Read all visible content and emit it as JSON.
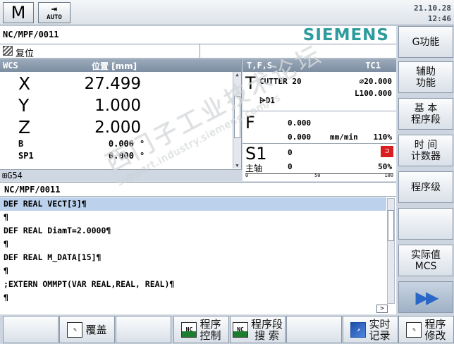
{
  "header": {
    "mode_jog_label": "M",
    "mode_auto_label": "AUTO",
    "date": "21.10.28",
    "time": "12:46"
  },
  "path": "NC/MPF/0011",
  "brand": "SIEMENS",
  "status": {
    "label": "复位"
  },
  "wcs": {
    "title": "WCS",
    "position_label": "位置 [mm]",
    "axes": [
      {
        "name": "X",
        "value": "27.499"
      },
      {
        "name": "Y",
        "value": "1.000"
      },
      {
        "name": "Z",
        "value": "2.000"
      }
    ],
    "aux_axes": [
      {
        "name": "B",
        "value": "0.000",
        "unit": "°"
      },
      {
        "name": "SP1",
        "value": "0.000",
        "unit": "°"
      }
    ],
    "footer": "G54"
  },
  "tfs": {
    "title": "T,F,S",
    "tool_count": "TC1",
    "t_letter": "T",
    "tool_name": "CUTTER 20",
    "tool_diameter": "⌀20.000",
    "tool_edge": "D1",
    "tool_length": "L100.000",
    "f_letter": "F",
    "f_value1": "0.000",
    "f_value2": "0.000",
    "f_unit": "mm/min",
    "f_override": "110%",
    "s_letter": "S1",
    "s_value": "0",
    "spindle_label": "主轴",
    "spindle_value": "0",
    "spindle_override": "50%",
    "scale_labels": [
      "0",
      "50",
      "100"
    ]
  },
  "program": {
    "title": "NC/MPF/0011",
    "lines": [
      "DEF REAL VECT[3]¶",
      "¶",
      "DEF REAL DiamT=2.0000¶",
      "¶",
      "DEF REAL M_DATA[15]¶",
      "¶",
      ";EXTERN OMMPT(VAR REAL,REAL, REAL)¶",
      "¶"
    ]
  },
  "right_softkeys": [
    "G功能",
    "辅助\n功能",
    "基 本\n程序段",
    "时 间\n计数器",
    "程序级",
    "",
    "实际值\nMCS",
    "▶▶"
  ],
  "bottom_softkeys": [
    {
      "label": "",
      "icon": ""
    },
    {
      "label": "覆盖",
      "icon": "override-icon"
    },
    {
      "label": "",
      "icon": ""
    },
    {
      "label": "程序\n控制",
      "icon": "nc-program-control-icon"
    },
    {
      "label": "程序段\n搜 索",
      "icon": "nc-block-search-icon"
    },
    {
      "label": "",
      "icon": ""
    },
    {
      "label": "实时\n记录",
      "icon": "realtime-record-icon"
    },
    {
      "label": "程序\n修改",
      "icon": "program-edit-icon"
    }
  ],
  "watermark": {
    "text": "西门子工业",
    "text2": "技术论坛",
    "url": "support.industry.siemens.com/cs"
  }
}
